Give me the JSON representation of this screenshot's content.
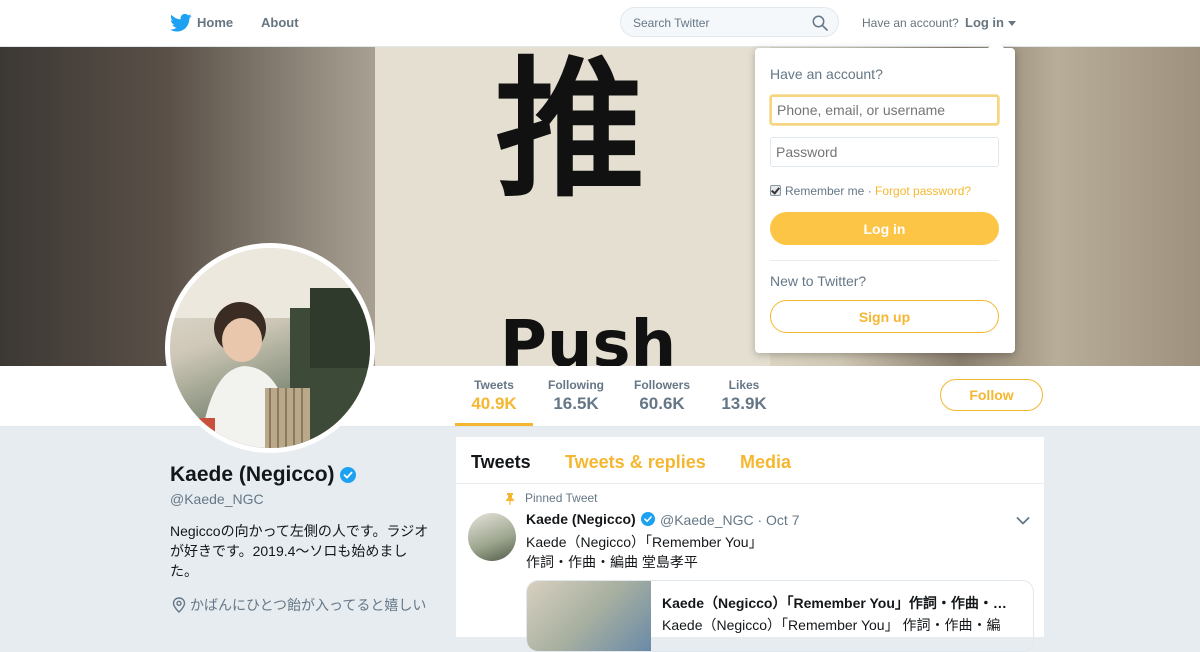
{
  "nav": {
    "home_label": "Home",
    "about_label": "About",
    "search_placeholder": "Search Twitter",
    "have_account": "Have an account?",
    "login_label": "Log in"
  },
  "banner": {
    "sign_char": "推",
    "sign_word": "Push"
  },
  "stats": [
    {
      "label": "Tweets",
      "value": "40.9K"
    },
    {
      "label": "Following",
      "value": "16.5K"
    },
    {
      "label": "Followers",
      "value": "60.6K"
    },
    {
      "label": "Likes",
      "value": "13.9K"
    }
  ],
  "follow_label": "Follow",
  "profile": {
    "name": "Kaede (Negicco)",
    "handle": "@Kaede_NGC",
    "bio": "Negiccoの向かって左側の人です。ラジオが好きです。2019.4～ソロも始めました。",
    "location": "かばんにひとつ飴が入ってると嬉しい"
  },
  "timeline": {
    "tabs": [
      "Tweets",
      "Tweets & replies",
      "Media"
    ],
    "pinned_label": "Pinned Tweet",
    "tweet": {
      "name": "Kaede (Negicco)",
      "handle": "@Kaede_NGC",
      "date": "Oct 7",
      "line1": "Kaede（Negicco）「Remember You」",
      "line2": "作詞・作曲・編曲 堂島孝平",
      "card_title": "Kaede（Negicco）「Remember You」作詞・作曲・…",
      "card_desc": "Kaede（Negicco）「Remember You」 作詞・作曲・編"
    }
  },
  "login_dropdown": {
    "heading": "Have an account?",
    "username_placeholder": "Phone, email, or username",
    "password_placeholder": "Password",
    "remember_label": "Remember me",
    "separator": " · ",
    "forgot_label": "Forgot password?",
    "login_button": "Log in",
    "new_label": "New to Twitter?",
    "signup_button": "Sign up"
  },
  "colors": {
    "accent": "#f5b731",
    "login_button_bg": "#fcc545",
    "twitter_blue": "#1da1f2"
  }
}
